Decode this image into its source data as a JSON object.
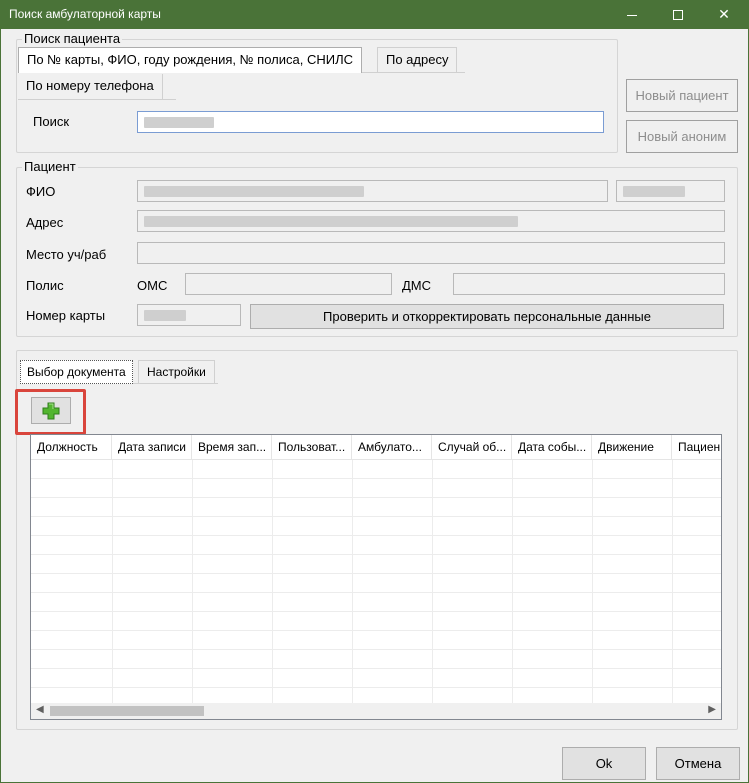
{
  "window": {
    "title": "Поиск амбулаторной карты",
    "minimize": "minimize",
    "maximize": "maximize",
    "close": "✕"
  },
  "search_group": {
    "legend": "Поиск пациента",
    "tabs": [
      {
        "label": "По № карты, ФИО, году рождения, № полиса, СНИЛС"
      },
      {
        "label": "По адресу"
      },
      {
        "label": "По номеру телефона"
      }
    ],
    "search_label": "Поиск"
  },
  "side_buttons": {
    "new_patient": "Новый пациент",
    "new_anonym": "Новый аноним"
  },
  "patient_group": {
    "legend": "Пациент",
    "fio_label": "ФИО",
    "address_label": "Адрес",
    "workplace_label": "Место уч/раб",
    "policy_label": "Полис",
    "oms_label": "ОМС",
    "dms_label": "ДМС",
    "card_label": "Номер карты",
    "verify_button": "Проверить и откорректировать персональные данные"
  },
  "doc_tabs": [
    {
      "label": "Выбор документа"
    },
    {
      "label": "Настройки"
    }
  ],
  "grid": {
    "columns": [
      "Должность",
      "Дата записи",
      "Время зап...",
      "Пользоват...",
      "Амбулато...",
      "Случай об...",
      "Дата собы...",
      "Движение",
      "Пациен"
    ]
  },
  "footer": {
    "ok": "Ok",
    "cancel": "Отмена"
  }
}
